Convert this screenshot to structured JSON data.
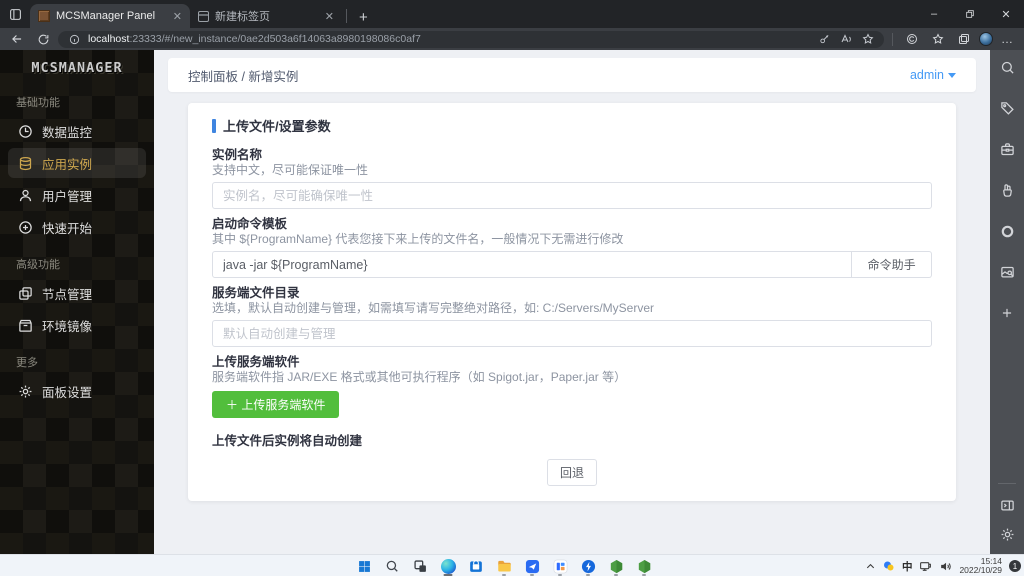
{
  "browser": {
    "tabs": [
      {
        "title": "MCSManager Panel"
      },
      {
        "title": "新建标签页"
      }
    ],
    "url": {
      "host": "localhost",
      "rest": ":23333/#/new_instance/0ae2d503a6f14063a8980198086c0af7"
    },
    "window_controls": {
      "minimize": "–",
      "close": "✕"
    },
    "more_menu": "…"
  },
  "app": {
    "logo": "MCSMANAGER",
    "nav": {
      "sections": [
        {
          "label": "基础功能",
          "items": [
            {
              "label": "数据监控"
            },
            {
              "label": "应用实例"
            },
            {
              "label": "用户管理"
            },
            {
              "label": "快速开始"
            }
          ]
        },
        {
          "label": "高级功能",
          "items": [
            {
              "label": "节点管理"
            },
            {
              "label": "环境镜像"
            }
          ]
        },
        {
          "label": "更多",
          "items": [
            {
              "label": "面板设置"
            }
          ]
        }
      ]
    },
    "header": {
      "breadcrumb": "控制面板 / 新增实例",
      "user": "admin"
    },
    "form": {
      "title": "上传文件/设置参数",
      "instance_name": {
        "label": "实例名称",
        "desc": "支持中文，尽可能保证唯一性",
        "placeholder": "实例名，尽可能确保唯一性"
      },
      "command": {
        "label": "启动命令模板",
        "desc": "其中 ${ProgramName} 代表您接下来上传的文件名，一般情况下无需进行修改",
        "value": "java -jar ${ProgramName}",
        "helper_button": "命令助手"
      },
      "directory": {
        "label": "服务端文件目录",
        "desc": "选填，默认自动创建与管理，如需填写请写完整绝对路径，如: C:/Servers/MyServer",
        "placeholder": "默认自动创建与管理"
      },
      "upload": {
        "label": "上传服务端软件",
        "desc": "服务端软件指 JAR/EXE 格式或其他可执行程序（如 Spigot.jar，Paper.jar 等）",
        "button": "＋ 上传服务端软件"
      },
      "note": "上传文件后实例将自动创建",
      "back_button": "回退"
    }
  },
  "taskbar": {
    "tray": {
      "ime": "中",
      "time": "15:14",
      "date": "2022/10/29",
      "badge": "1"
    }
  },
  "colors": {
    "accent_blue": "#3f85e0",
    "accent_green": "#52be3c",
    "sidebar_gold": "#cda64e"
  }
}
